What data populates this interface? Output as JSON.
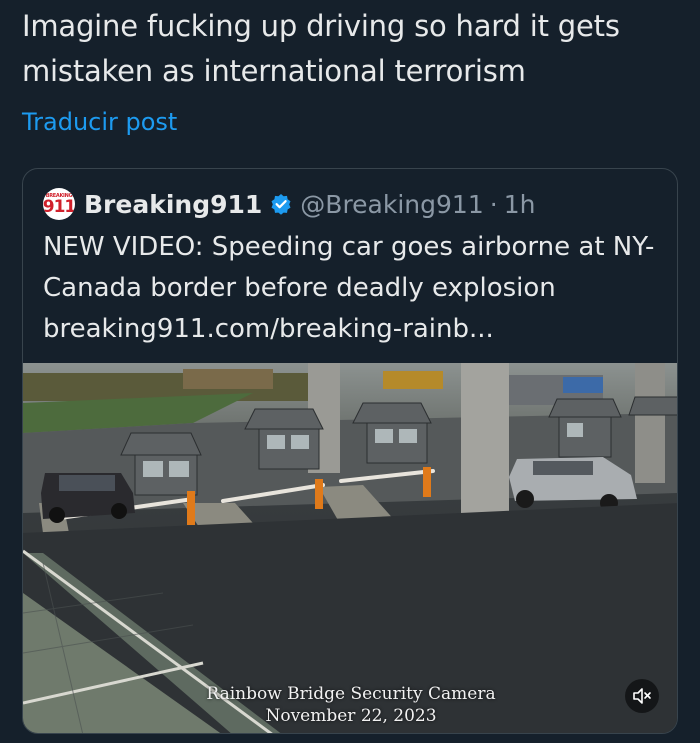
{
  "post": {
    "text": "Imagine fucking up driving so hard it gets mistaken as international terrorism",
    "translate_label": "Traducir post"
  },
  "quote": {
    "avatar_small": "BREAKING",
    "avatar_num": "911",
    "name": "Breaking911",
    "handle": "@Breaking911",
    "separator": "·",
    "time": "1h",
    "text": "NEW VIDEO: Speeding car goes airborne at NY-Canada border before deadly explosion",
    "link": "breaking911.com/breaking-rainb..."
  },
  "media": {
    "caption_line1": "Rainbow Bridge Security Camera",
    "caption_line2": "November 22, 2023",
    "mute_icon": "speaker-muted-icon"
  },
  "colors": {
    "background": "#15202b",
    "accent": "#1d9bf0",
    "verified": "#1d9bf0",
    "muted_text": "#8b98a5"
  }
}
